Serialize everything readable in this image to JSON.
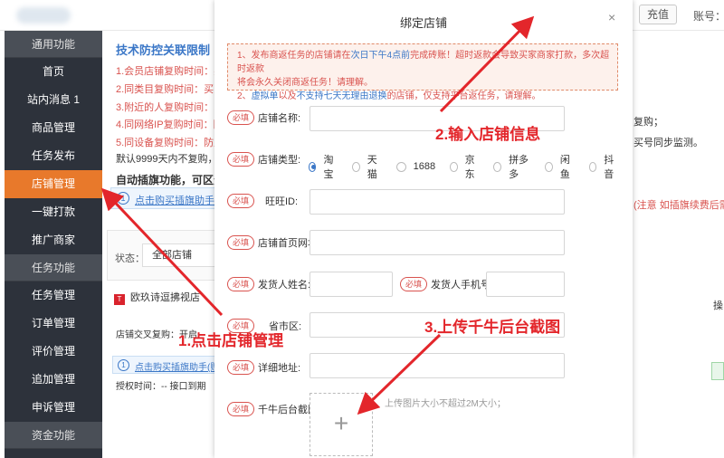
{
  "topbar": {
    "recharge_label": "充值",
    "account_label": "账号：",
    "hint_right": "帐号："
  },
  "sidebar": {
    "group1": "通用功能",
    "items1": [
      "首页",
      "站内消息 1",
      "商品管理",
      "任务发布",
      "店铺管理",
      "一键打款",
      "推广商家"
    ],
    "group2": "任务功能",
    "items2": [
      "任务管理",
      "订单管理",
      "评价管理",
      "追加管理",
      "申诉管理"
    ],
    "group3": "资金功能"
  },
  "background": {
    "title": "技术防控关联限制（",
    "lines": [
      "1.会员店铺复购时间：买家",
      "2.同类目复购时间：买家",
      "3.附近的人复购时间：系统",
      "4.同网络IP复购时间：防止",
      "5.同设备复购时间：防止一",
      "默认9999天内不复购，进一"
    ],
    "bold": "自动插旗功能，可区分",
    "help_link": "点击购买插旗助手（",
    "status_label": "状态：",
    "status_value": "全部店铺",
    "shop_name": "欧玖诗逗拂视店",
    "row1": "店铺交叉复购：开启",
    "help_link2": "点击购买插旗助手(赠",
    "row2": "授权时间：--    接口到期",
    "right1": "复购；",
    "right2": "买号同步监测。",
    "right_red": "(注意 如插旗续费后需要",
    "right3": "操"
  },
  "modal": {
    "title": "绑定店铺",
    "close": "×",
    "notice": {
      "l1_a": "1、发布商返任务的店铺请在",
      "l1_b": "次日下午4点前",
      "l1_c": "完成砖账！超时返款会导致买家商家打款，多次超时返款",
      "l2": "将会永久关闭商返任务！请理解。",
      "l3_a": "2、",
      "l3_b": "虚拟单",
      "l3_c": "以及",
      "l3_d": "不支持七天无理由退换",
      "l3_e": "的店铺，仅支持平台返任务，请理解。"
    },
    "required": "必填",
    "fields": {
      "shop_name": "店铺名称:",
      "shop_type": "店铺类型:",
      "wangwang": "旺旺ID:",
      "homepage": "店铺首页网址:",
      "sender_name": "发货人姓名:",
      "sender_phone": "发货人手机号:",
      "region": "省市区:",
      "address": "详细地址:",
      "screenshot": "千牛后台截图:"
    },
    "shop_types": [
      "淘宝",
      "天猫",
      "1688",
      "京东",
      "拼多多",
      "闲鱼",
      "抖音"
    ],
    "selected_type": "淘宝",
    "upload_plus": "+",
    "upload_hint": "上传图片大小不超过2M大小；"
  },
  "annotations": {
    "step1": "1.点击店铺管理",
    "step2": "2.输入店铺信息",
    "step3": "3.上传千牛后台截图",
    "color": "#e3262b"
  }
}
